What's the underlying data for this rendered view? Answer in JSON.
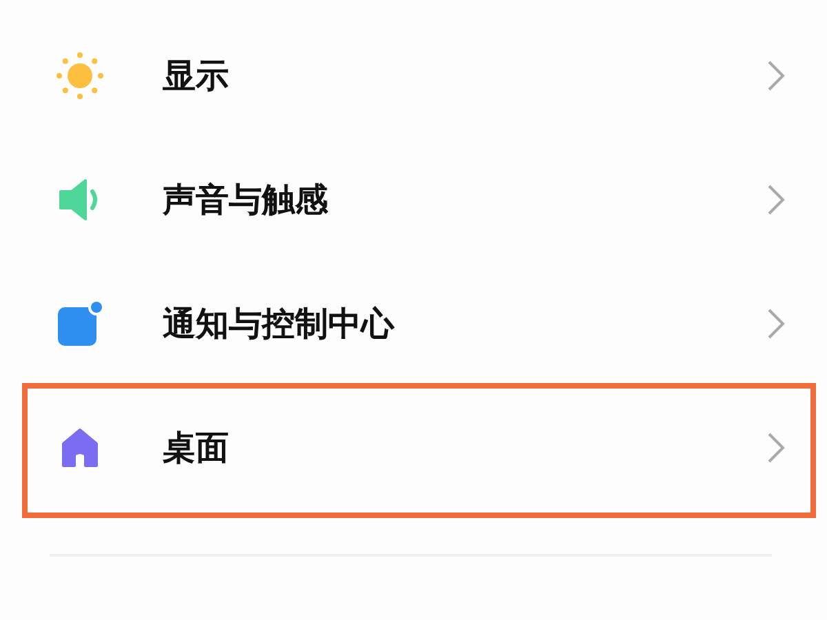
{
  "settings_items": [
    {
      "label": "显示",
      "highlighted": false
    },
    {
      "label": "声音与触感",
      "highlighted": false
    },
    {
      "label": "通知与控制中心",
      "highlighted": false
    },
    {
      "label": "桌面",
      "highlighted": true
    }
  ]
}
